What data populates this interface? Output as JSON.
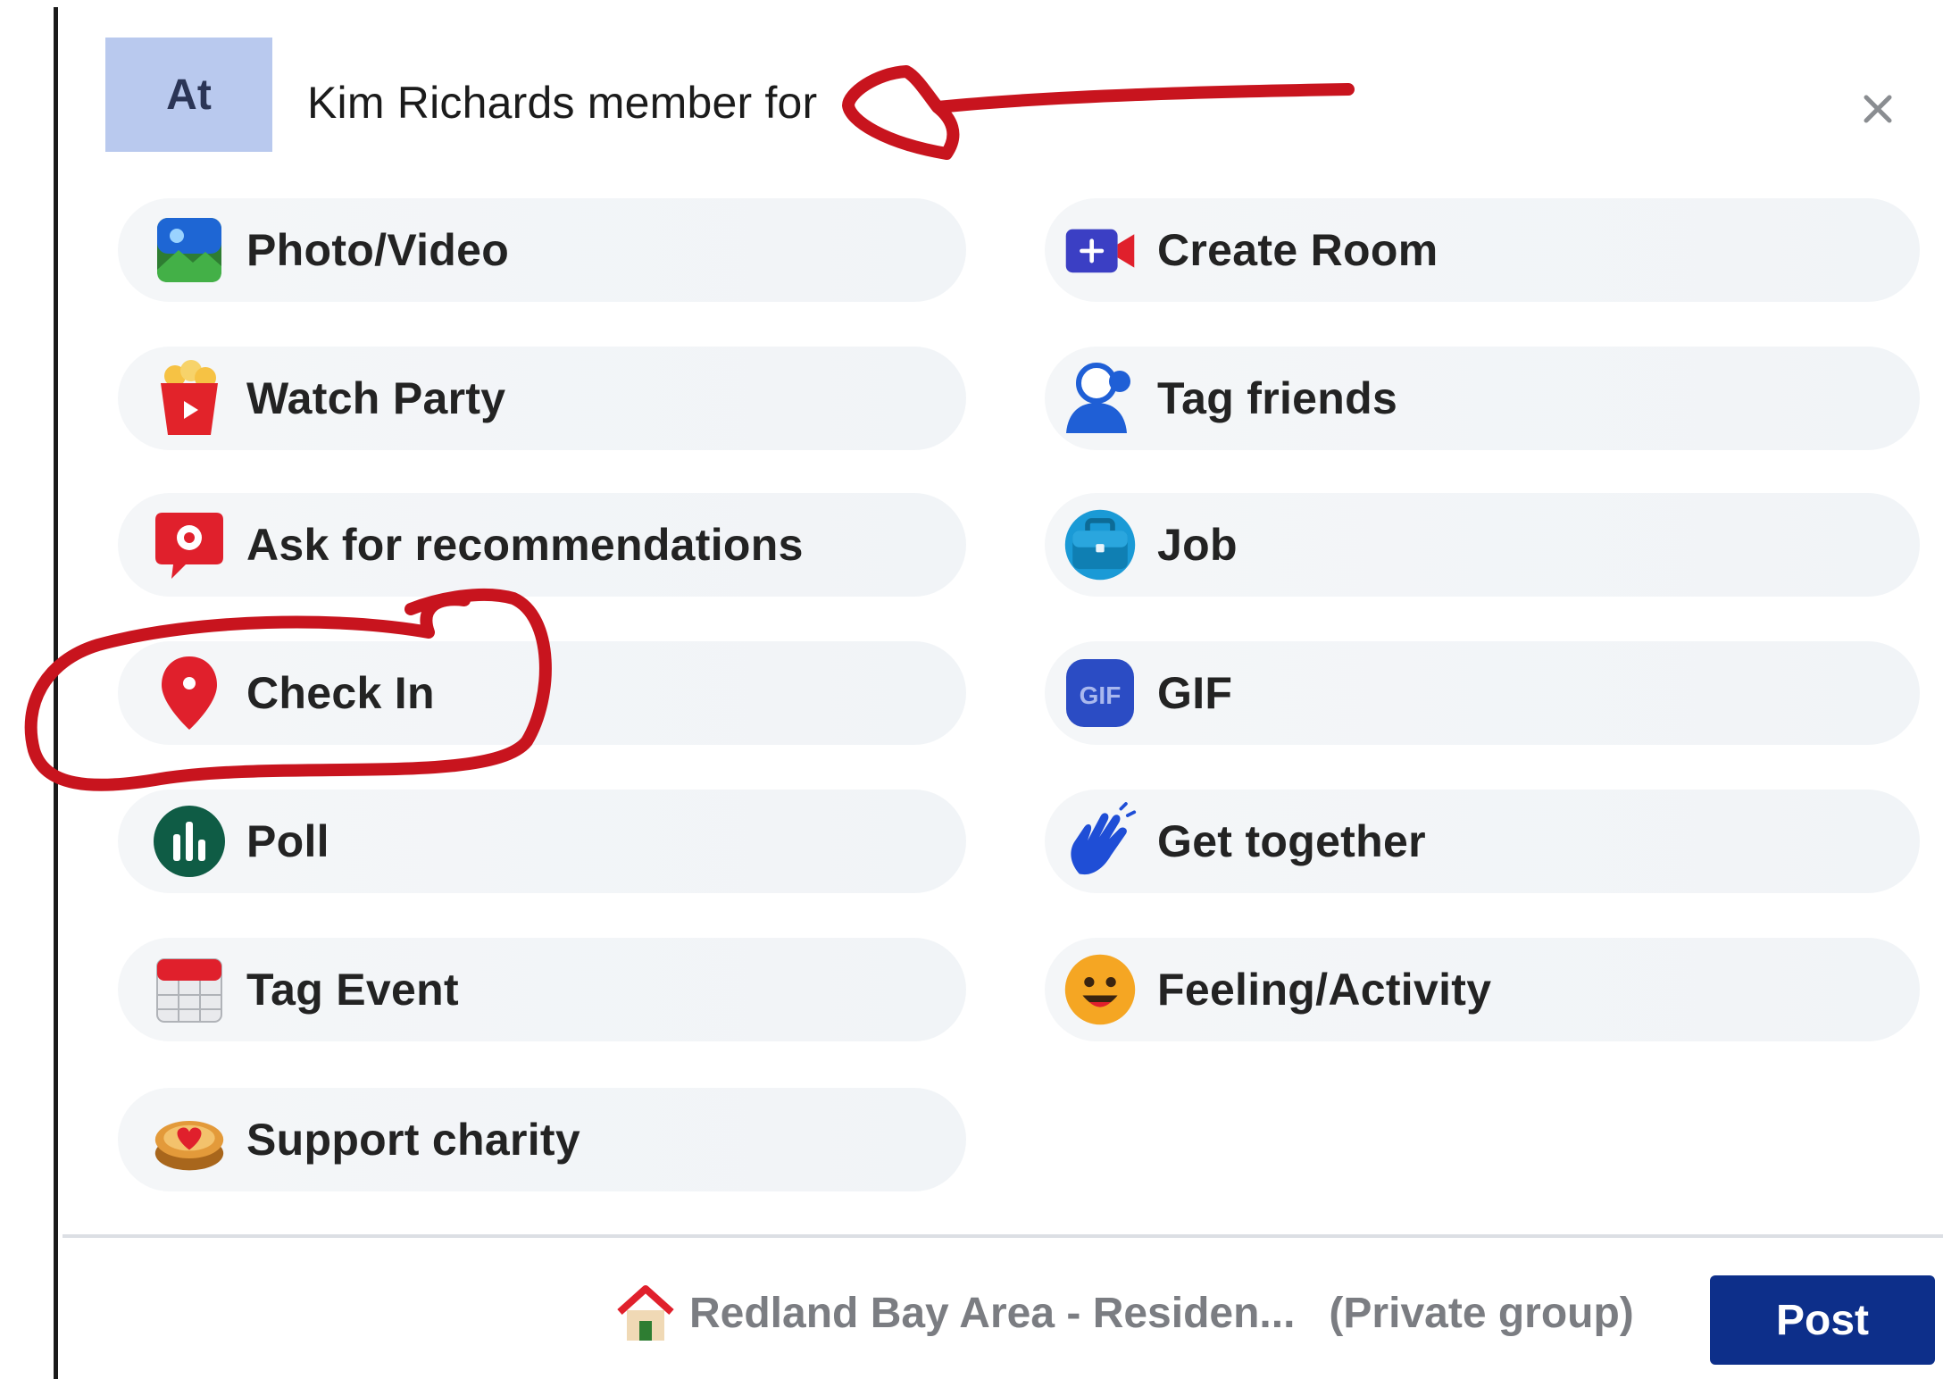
{
  "header": {
    "avatar_text": "At",
    "title": "Kim Richards member for"
  },
  "options": {
    "left": [
      {
        "label": "Photo/Video",
        "icon": "photo-video-icon"
      },
      {
        "label": "Watch Party",
        "icon": "watch-party-icon"
      },
      {
        "label": "Ask for recommendations",
        "icon": "recommendations-icon"
      },
      {
        "label": "Check In",
        "icon": "location-pin-icon"
      },
      {
        "label": "Poll",
        "icon": "poll-icon"
      },
      {
        "label": "Tag Event",
        "icon": "calendar-icon"
      },
      {
        "label": "Support charity",
        "icon": "charity-icon"
      }
    ],
    "right": [
      {
        "label": "Create Room",
        "icon": "video-room-icon"
      },
      {
        "label": "Tag friends",
        "icon": "tag-friends-icon"
      },
      {
        "label": "Job",
        "icon": "briefcase-icon"
      },
      {
        "label": "GIF",
        "icon": "gif-icon"
      },
      {
        "label": "Get together",
        "icon": "wave-hand-icon"
      },
      {
        "label": "Feeling/Activity",
        "icon": "smiley-icon"
      }
    ]
  },
  "footer": {
    "group_name": "Redland Bay Area - Residen...",
    "group_privacy": "(Private group)",
    "post_label": "Post"
  },
  "colors": {
    "post_button": "#0d2f8a",
    "annotation_red": "#c8141e",
    "avatar_bg": "#b9c9ee"
  }
}
